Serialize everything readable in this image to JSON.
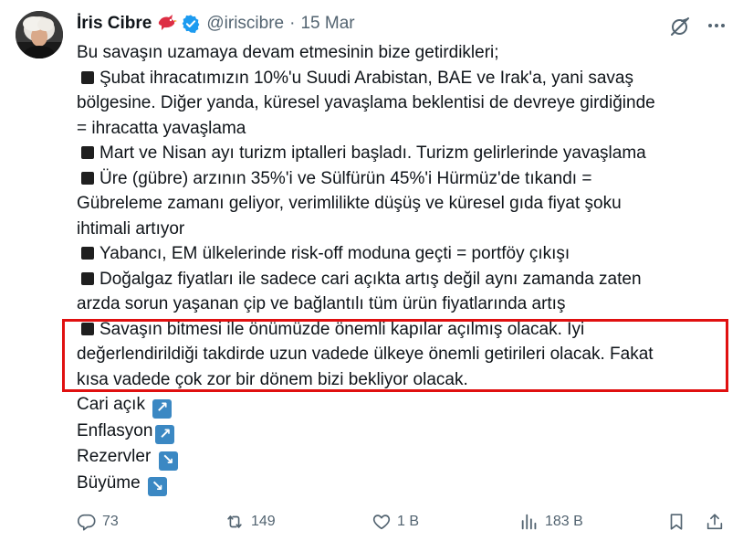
{
  "author": {
    "name": "İris Cibre",
    "handle": "@iriscibre",
    "separator": "·",
    "date": "15 Mar"
  },
  "tweet": {
    "lines": [
      "Bu savaşın uzamaya devam etmesinin bize getirdikleri;",
      "Şubat ihracatımızın 10%'u Suudi Arabistan, BAE ve Irak'a, yani savaş",
      "bölgesine. Diğer yanda, küresel yavaşlama beklentisi de devreye girdiğinde",
      "= ihracatta yavaşlama",
      "Mart ve Nisan ayı turizm iptalleri başladı. Turizm gelirlerinde yavaşlama",
      "Üre (gübre) arzının 35%'i ve Sülfürün 45%'i Hürmüz'de tıkandı =",
      "Gübreleme zamanı geliyor, verimlilikte düşüş ve küresel gıda fiyat şoku",
      "ihtimali artıyor",
      "Yabancı, EM ülkelerinde risk-off moduna geçti = portföy çıkışı",
      "Doğalgaz fiyatları ile sadece cari açıkta artış değil aynı zamanda zaten",
      "arzda sorun yaşanan çip ve bağlantılı tüm ürün fiyatlarında artış",
      "Savaşın bitmesi ile önümüzde önemli kapılar açılmış olacak. İyi",
      "değerlendirildiği takdirde uzun vadede ülkeye önemli getirileri olacak. Fakat",
      "kısa vadede çok zor bir dönem bizi bekliyor olacak.",
      "Cari açık",
      "Enflasyon",
      "Rezervler",
      "Büyüme"
    ],
    "indicators": [
      {
        "label": "Cari açık",
        "arrow": "↗"
      },
      {
        "label": "Enflasyon",
        "arrow": "↗"
      },
      {
        "label": "Rezervler",
        "arrow": "↘"
      },
      {
        "label": "Büyüme",
        "arrow": "↘"
      }
    ]
  },
  "actions": {
    "replies": "73",
    "reposts": "149",
    "likes": "1 B",
    "views": "183 B"
  },
  "colors": {
    "text": "#0f1419",
    "muted": "#536471",
    "verified": "#1d9bf0",
    "highlight": "#e01010",
    "arrow_badge": "#3b88c3"
  },
  "icons": {
    "reply": "reply-icon",
    "repost": "repost-icon",
    "like": "heart-icon",
    "views": "views-icon",
    "bookmark": "bookmark-icon",
    "share": "share-icon",
    "grok": "grok-icon",
    "more": "more-icon"
  }
}
